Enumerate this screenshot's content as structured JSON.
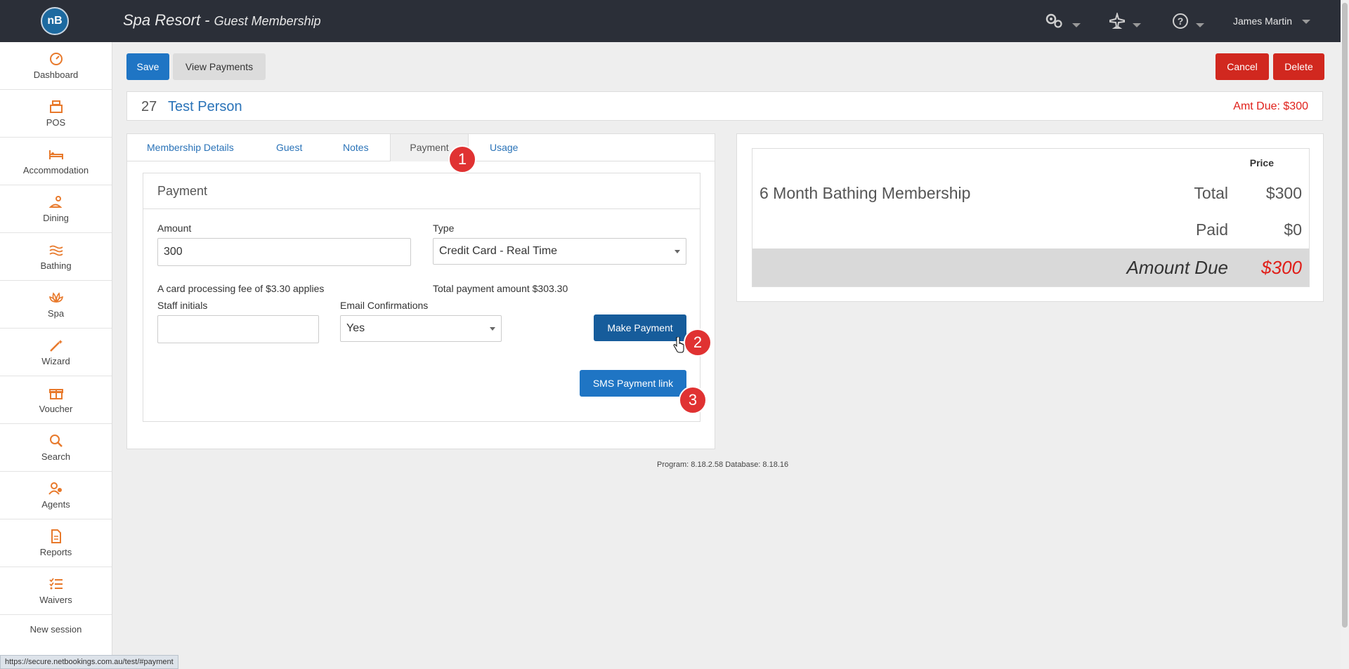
{
  "app": {
    "logo_text": "nB",
    "title": "Spa Resort",
    "separator": " - ",
    "subtitle": "Guest Membership",
    "user": "James Martin"
  },
  "topbar_icons": [
    "gears-icon",
    "plane-icon",
    "help-icon"
  ],
  "sidebar": {
    "items": [
      {
        "label": "Dashboard",
        "icon": "dashboard-icon"
      },
      {
        "label": "POS",
        "icon": "cash-register-icon"
      },
      {
        "label": "Accommodation",
        "icon": "bed-icon"
      },
      {
        "label": "Dining",
        "icon": "dining-icon"
      },
      {
        "label": "Bathing",
        "icon": "water-icon"
      },
      {
        "label": "Spa",
        "icon": "lotus-icon"
      },
      {
        "label": "Wizard",
        "icon": "wand-icon"
      },
      {
        "label": "Voucher",
        "icon": "gift-icon"
      },
      {
        "label": "Search",
        "icon": "search-icon"
      },
      {
        "label": "Agents",
        "icon": "agents-icon"
      },
      {
        "label": "Reports",
        "icon": "report-icon"
      },
      {
        "label": "Waivers",
        "icon": "checklist-icon"
      }
    ],
    "new_session": "New session"
  },
  "toolbar": {
    "save": "Save",
    "view_payments": "View Payments",
    "cancel": "Cancel",
    "delete": "Delete"
  },
  "record": {
    "number": "27",
    "name": "Test Person",
    "amount_due": "Amt Due: $300"
  },
  "tabs": [
    "Membership Details",
    "Guest",
    "Notes",
    "Payment",
    "Usage"
  ],
  "payment": {
    "heading": "Payment",
    "amount_label": "Amount",
    "amount_value": "300",
    "type_label": "Type",
    "type_value": "Credit Card - Real Time",
    "fee_note": "A card processing fee of $3.30 applies",
    "total_note": "Total payment amount $303.30",
    "staff_label": "Staff initials",
    "staff_value": "",
    "email_label": "Email Confirmations",
    "email_value": "Yes",
    "make_payment": "Make Payment",
    "sms_link": "SMS Payment link"
  },
  "badges": [
    "1",
    "2",
    "3"
  ],
  "summary": {
    "price_header": "Price",
    "item": "6 Month Bathing Membership",
    "total_label": "Total",
    "total_value": "$300",
    "paid_label": "Paid",
    "paid_value": "$0",
    "due_label": "Amount Due",
    "due_value": "$300"
  },
  "version": "Program: 8.18.2.58 Database: 8.18.16",
  "status_url": "https://secure.netbookings.com.au/test/#payment",
  "colors": {
    "primary": "#1f75c4",
    "danger": "#d1281f",
    "accent_orange": "#e8792b",
    "topbar": "#2b2f38"
  }
}
